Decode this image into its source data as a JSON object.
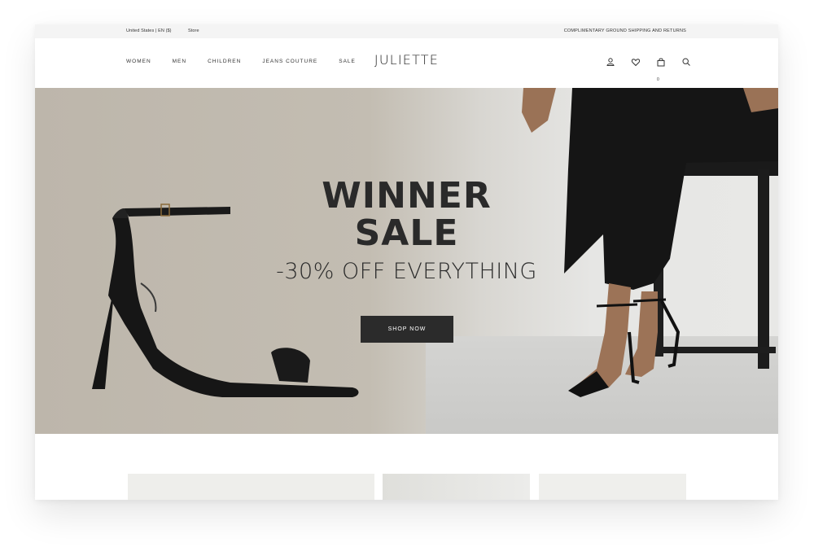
{
  "topbar": {
    "locale": "United States | EN ($)",
    "store": "Store",
    "promo": "COMPLIMENTARY GROUND SHIPPING AND RETURNS"
  },
  "nav": {
    "links": [
      "WOMEN",
      "MEN",
      "CHILDREN",
      "JEANS COUTURE",
      "SALE"
    ],
    "brand": "JULIETTE",
    "icons": [
      "account-icon",
      "heart-icon",
      "bag-icon",
      "search-icon"
    ],
    "cart_count": "0"
  },
  "hero": {
    "title_line1": "WINNER",
    "title_line2": "SALE",
    "subtitle": "-30% OFF EVERYTHING",
    "cta": "SHOP NOW"
  },
  "colors": {
    "hero_bg": "#bdb6ab",
    "button_bg": "#2b2b2b",
    "topbar_bg": "#f4f4f4"
  }
}
